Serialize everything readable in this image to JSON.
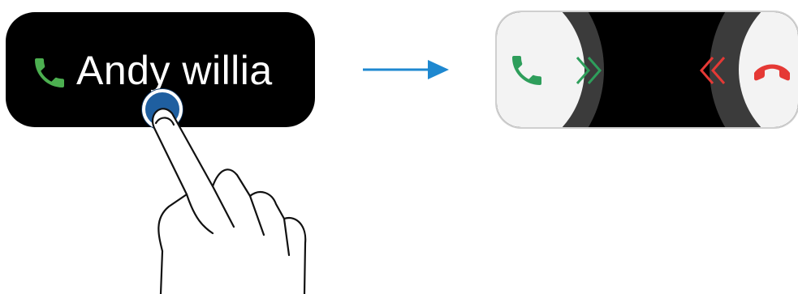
{
  "incoming_call": {
    "caller_name": "Andy willia",
    "icon": "phone-icon",
    "accent_color": "#4caf50"
  },
  "gesture": {
    "type": "tap",
    "touch_color": "#1f5fa0"
  },
  "transition_arrow": {
    "icon": "arrow-right-icon",
    "color": "#1e88d0"
  },
  "call_controls": {
    "accept_icon": "phone-accept-icon",
    "reject_icon": "phone-reject-icon",
    "accept_color": "#2e9e5b",
    "reject_color": "#e53935",
    "swipe_hint_accept": "chevron-right-double-icon",
    "swipe_hint_reject": "chevron-left-double-icon"
  }
}
